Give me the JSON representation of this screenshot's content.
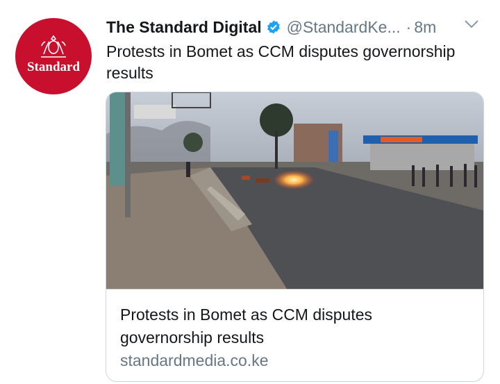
{
  "tweet": {
    "avatar": {
      "logo_text": "Standard",
      "brand_color": "#c8102e",
      "icon": "crest-icon"
    },
    "display_name": "The Standard Digital",
    "verified_icon": "verified-badge-icon",
    "handle": "@StandardKe...",
    "separator": "·",
    "time": "8m",
    "menu_icon": "chevron-down-icon",
    "text_lines": [
      "Protests in Bomet as CCM disputes governorship",
      "results"
    ]
  },
  "card": {
    "image_alt": "photo-street-protest-fire",
    "title_lines": [
      "Protests in Bomet as CCM disputes",
      "governorship results"
    ],
    "domain": "standardmedia.co.ke"
  },
  "colors": {
    "accent": "#1da1f2",
    "muted": "#657786",
    "text": "#14171a",
    "border": "#ccd6dd"
  }
}
